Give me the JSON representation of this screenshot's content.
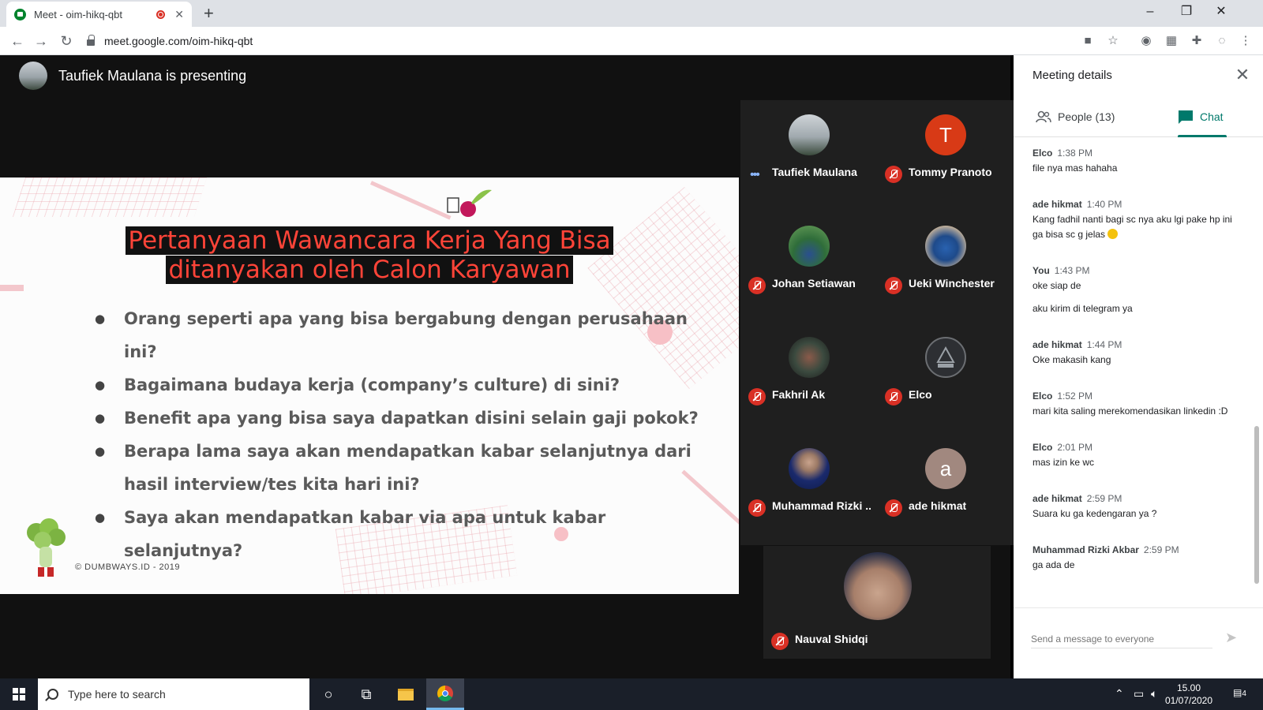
{
  "browser": {
    "tab_title": "Meet - oim-hikq-qbt",
    "url": "meet.google.com/oim-hikq-qbt"
  },
  "meet": {
    "presenting_text": "Taufiek Maulana is presenting"
  },
  "slide": {
    "title_line1": "Pertanyaan Wawancara Kerja Yang Bisa",
    "title_line2": "ditanyakan oleh Calon Karyawan",
    "bullets": [
      "Orang seperti apa yang bisa bergabung dengan perusahaan ini?",
      "Bagaimana budaya kerja (company’s culture) di sini?",
      "Benefit apa yang bisa saya dapatkan disini selain gaji pokok?",
      "Berapa lama saya akan mendapatkan kabar selanjutnya dari hasil interview/tes kita hari ini?",
      "Saya akan mendapatkan kabar via apa untuk kabar selanjutnya?"
    ],
    "copyright": "© DUMBWAYS.ID - 2019"
  },
  "participants": [
    {
      "name": "Taufiek Maulana",
      "initial": "",
      "muted": false
    },
    {
      "name": "Tommy Pranoto",
      "initial": "T",
      "muted": true
    },
    {
      "name": "Johan Setiawan",
      "initial": "",
      "muted": true
    },
    {
      "name": "Ueki Winchester",
      "initial": "",
      "muted": true
    },
    {
      "name": "Fakhril Ak",
      "initial": "",
      "muted": true
    },
    {
      "name": "Elco",
      "initial": "",
      "muted": true
    },
    {
      "name": "Muhammad Rizki ...",
      "initial": "",
      "muted": true
    },
    {
      "name": "ade hikmat",
      "initial": "a",
      "muted": true
    },
    {
      "name": "Nauval Shidqi",
      "initial": "",
      "muted": true
    }
  ],
  "panel": {
    "title": "Meeting details",
    "tab_people": "People (13)",
    "tab_chat": "Chat",
    "messages": [
      {
        "sender": "Elco",
        "time": "1:38 PM",
        "lines": [
          "file nya mas hahaha"
        ]
      },
      {
        "sender": "ade hikmat",
        "time": "1:40 PM",
        "lines": [
          "Kang fadhil nanti bagi sc nya aku lgi pake hp ini ga bisa sc g jelas"
        ]
      },
      {
        "sender": "You",
        "time": "1:43 PM",
        "lines": [
          "oke siap de",
          "aku kirim di telegram ya"
        ]
      },
      {
        "sender": "ade hikmat",
        "time": "1:44 PM",
        "lines": [
          "Oke makasih kang"
        ]
      },
      {
        "sender": "Elco",
        "time": "1:52 PM",
        "lines": [
          "mari kita saling merekomendasikan linkedin :D"
        ]
      },
      {
        "sender": "Elco",
        "time": "2:01 PM",
        "lines": [
          "mas izin ke wc"
        ]
      },
      {
        "sender": "ade hikmat",
        "time": "2:59 PM",
        "lines": [
          "Suara ku ga kedengaran ya ?"
        ]
      },
      {
        "sender": "Muhammad Rizki Akbar",
        "time": "2:59 PM",
        "lines": [
          "ga ada de"
        ]
      }
    ],
    "composer_placeholder": "Send a message to everyone"
  },
  "taskbar": {
    "search_placeholder": "Type here to search",
    "time": "15.00",
    "date": "01/07/2020",
    "notification_count": "4"
  }
}
